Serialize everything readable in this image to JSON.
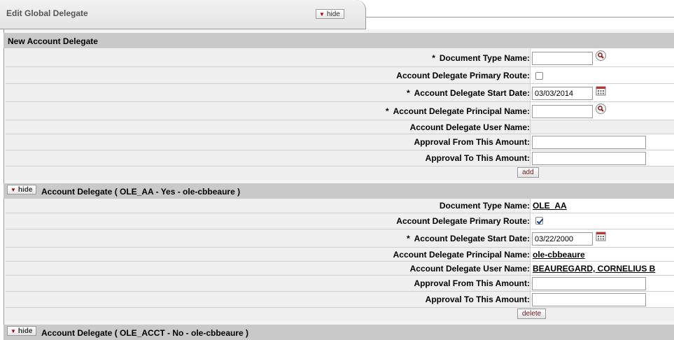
{
  "tab": {
    "title": "Edit Global Delegate",
    "hide_label": "hide"
  },
  "new_delegate": {
    "heading": "New Account Delegate",
    "document_type_label": "Document Type Name:",
    "primary_route_label": "Account Delegate Primary Route:",
    "start_date_label": "Account Delegate Start Date:",
    "start_date_value": "03/03/2014",
    "principal_label": "Account Delegate Principal Name:",
    "user_name_label": "Account Delegate User Name:",
    "approval_from_label": "Approval From This Amount:",
    "approval_to_label": "Approval To This Amount:",
    "add_label": "add",
    "required_mark": "*"
  },
  "delegate1": {
    "hide_label": "hide",
    "heading": "Account Delegate ( OLE_AA - Yes - ole-cbbeaure )",
    "document_type_label": "Document Type Name:",
    "document_type_value": "OLE_AA",
    "primary_route_label": "Account Delegate Primary Route:",
    "primary_route_checked": true,
    "start_date_label": "Account Delegate Start Date:",
    "start_date_value": "03/22/2000",
    "principal_label": "Account Delegate Principal Name:",
    "principal_value": "ole-cbbeaure",
    "user_name_label": "Account Delegate User Name:",
    "user_name_value": "BEAUREGARD, CORNELIUS B",
    "approval_from_label": "Approval From This Amount:",
    "approval_to_label": "Approval To This Amount:",
    "delete_label": "delete",
    "required_mark": "*"
  },
  "delegate2": {
    "hide_label": "hide",
    "heading": "Account Delegate ( OLE_ACCT - No - ole-cbbeaure )"
  },
  "icons": {
    "lookup": "magnifier-icon",
    "calendar": "calendar-icon",
    "collapse": "triangle-down-icon"
  },
  "colors": {
    "section_header": "#c9c9c9",
    "row_bg": "#efefef",
    "button_text": "#6a1a1a",
    "collapse_triangle": "#aa0000",
    "checkbox_check": "#1a3a8a"
  }
}
